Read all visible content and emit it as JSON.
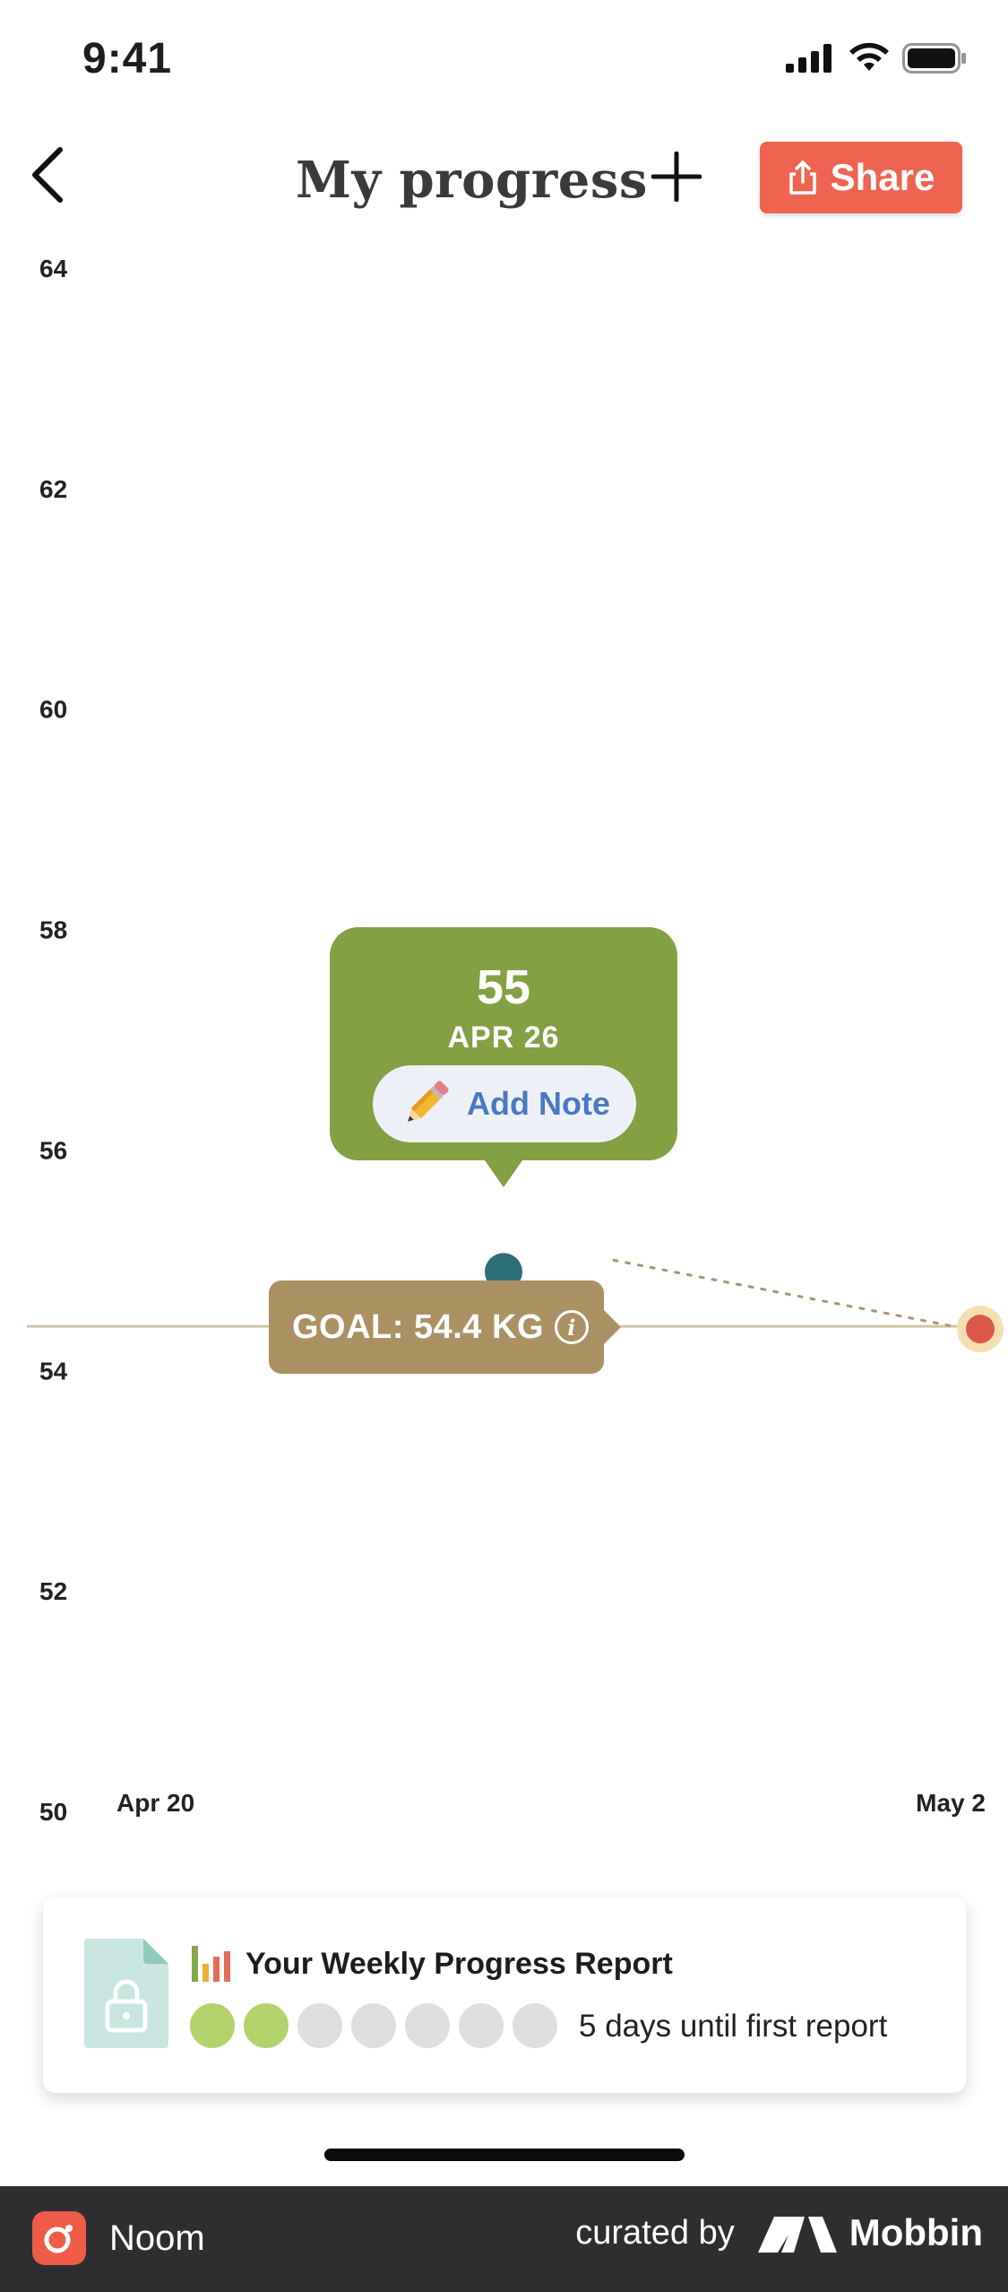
{
  "status_bar": {
    "time": "9:41"
  },
  "header": {
    "title": "My progress",
    "share_label": "Share"
  },
  "chart_data": {
    "type": "line",
    "ytick_labels": [
      "64",
      "62",
      "60",
      "58",
      "56",
      "54",
      "52",
      "50"
    ],
    "ylim": [
      50,
      64
    ],
    "xtick_labels": [
      "Apr 20",
      "May 2"
    ],
    "series": [
      {
        "points": [
          {
            "x": "Apr 26",
            "y": 55
          },
          {
            "x": "May 2",
            "y": 54.4
          }
        ]
      }
    ],
    "goal": 54.4,
    "grid": false,
    "colors": {
      "point": "#2d6e78",
      "goal_point": "#d9584a",
      "goal_line": "#cfc4a8"
    }
  },
  "tooltip": {
    "value": "55",
    "date": "APR 26",
    "add_note_label": "Add Note"
  },
  "goal": {
    "label": "GOAL: 54.4 KG"
  },
  "report": {
    "title": "Your Weekly Progress Report",
    "dots_total": 7,
    "dots_filled": 2,
    "status": "5 days until first report"
  },
  "footer": {
    "app_name": "Noom",
    "curated_by": "curated by",
    "brand": "Mobbin"
  },
  "colors": {
    "accent": "#ee6451",
    "tooltip": "#83a042",
    "goal_label": "#ab9162",
    "dot_filled": "#b4d26c"
  }
}
